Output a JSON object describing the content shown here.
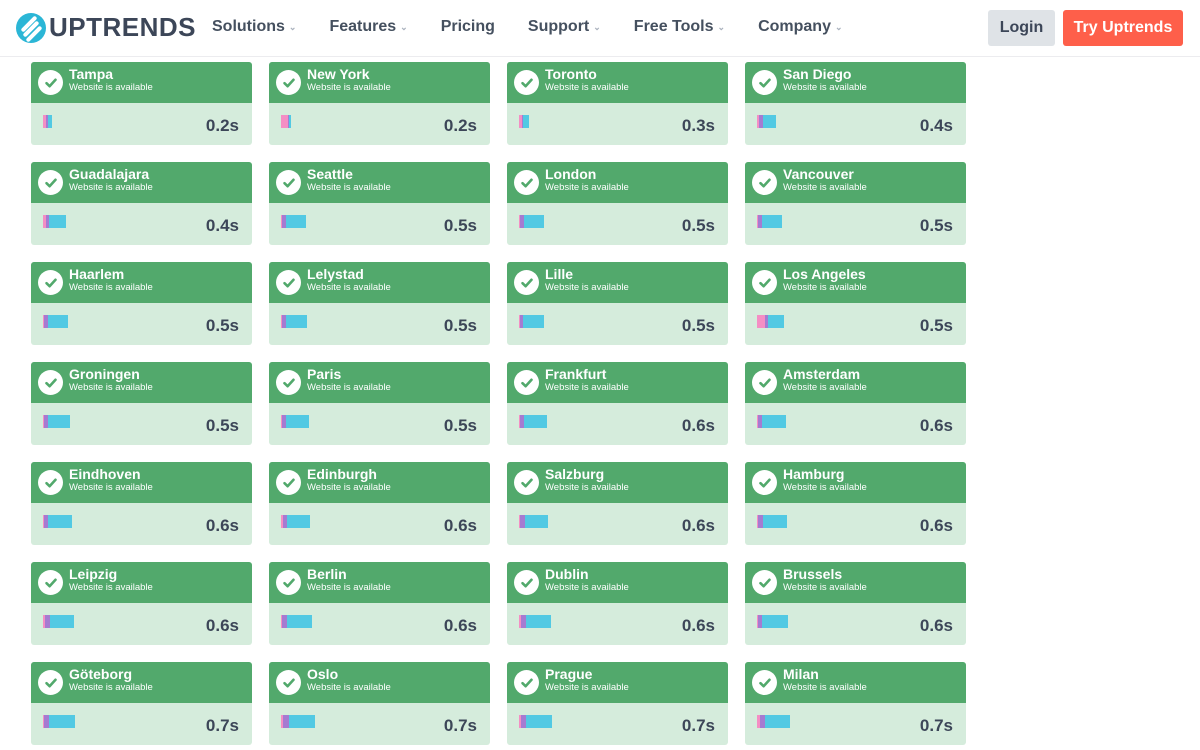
{
  "brand": {
    "name": "UPTRENDS",
    "logo_icon": "uptrends-logo-icon",
    "accent": "#2bb6d6"
  },
  "nav": {
    "items": [
      {
        "label": "Solutions",
        "dropdown": true
      },
      {
        "label": "Features",
        "dropdown": true
      },
      {
        "label": "Pricing",
        "dropdown": false
      },
      {
        "label": "Support",
        "dropdown": true
      },
      {
        "label": "Free Tools",
        "dropdown": true
      },
      {
        "label": "Company",
        "dropdown": true
      }
    ],
    "chevron": "⌄",
    "login_label": "Login",
    "try_label": "Try Uptrends"
  },
  "colors": {
    "card_header": "#52a96c",
    "card_body": "#d5ecdc",
    "dns": "#f48ec4",
    "connect": "#a57bd1",
    "download": "#52c9e3",
    "cta": "#fe5f4a"
  },
  "checkpoints": [
    {
      "city": "Tampa",
      "status": "Website is available",
      "time": "0.2s",
      "segments": [
        30,
        20,
        50
      ]
    },
    {
      "city": "New York",
      "status": "Website is available",
      "time": "0.2s",
      "segments": [
        80,
        15,
        25
      ]
    },
    {
      "city": "Toronto",
      "status": "Website is available",
      "time": "0.3s",
      "segments": [
        30,
        15,
        75
      ]
    },
    {
      "city": "San Diego",
      "status": "Website is available",
      "time": "0.4s",
      "segments": [
        25,
        45,
        150
      ]
    },
    {
      "city": "Guadalajara",
      "status": "Website is available",
      "time": "0.4s",
      "segments": [
        35,
        40,
        200
      ]
    },
    {
      "city": "Seattle",
      "status": "Website is available",
      "time": "0.5s",
      "segments": [
        15,
        45,
        240
      ]
    },
    {
      "city": "London",
      "status": "Website is available",
      "time": "0.5s",
      "segments": [
        10,
        45,
        230
      ]
    },
    {
      "city": "Vancouver",
      "status": "Website is available",
      "time": "0.5s",
      "segments": [
        10,
        50,
        230
      ]
    },
    {
      "city": "Haarlem",
      "status": "Website is available",
      "time": "0.5s",
      "segments": [
        10,
        45,
        230
      ]
    },
    {
      "city": "Lelystad",
      "status": "Website is available",
      "time": "0.5s",
      "segments": [
        10,
        45,
        245
      ]
    },
    {
      "city": "Lille",
      "status": "Website is available",
      "time": "0.5s",
      "segments": [
        15,
        40,
        250
      ]
    },
    {
      "city": "Los Angeles",
      "status": "Website is available",
      "time": "0.5s",
      "segments": [
        90,
        35,
        190
      ]
    },
    {
      "city": "Groningen",
      "status": "Website is available",
      "time": "0.5s",
      "segments": [
        10,
        50,
        255
      ]
    },
    {
      "city": "Paris",
      "status": "Website is available",
      "time": "0.5s",
      "segments": [
        15,
        45,
        265
      ]
    },
    {
      "city": "Frankfurt",
      "status": "Website is available",
      "time": "0.6s",
      "segments": [
        10,
        45,
        275
      ]
    },
    {
      "city": "Amsterdam",
      "status": "Website is available",
      "time": "0.6s",
      "segments": [
        10,
        50,
        280
      ]
    },
    {
      "city": "Eindhoven",
      "status": "Website is available",
      "time": "0.6s",
      "segments": [
        10,
        50,
        285
      ]
    },
    {
      "city": "Edinburgh",
      "status": "Website is available",
      "time": "0.6s",
      "segments": [
        20,
        45,
        275
      ]
    },
    {
      "city": "Salzburg",
      "status": "Website is available",
      "time": "0.6s",
      "segments": [
        15,
        55,
        275
      ]
    },
    {
      "city": "Hamburg",
      "status": "Website is available",
      "time": "0.6s",
      "segments": [
        15,
        55,
        280
      ]
    },
    {
      "city": "Leipzig",
      "status": "Website is available",
      "time": "0.6s",
      "segments": [
        20,
        55,
        285
      ]
    },
    {
      "city": "Berlin",
      "status": "Website is available",
      "time": "0.6s",
      "segments": [
        10,
        60,
        295
      ]
    },
    {
      "city": "Dublin",
      "status": "Website is available",
      "time": "0.6s",
      "segments": [
        20,
        55,
        295
      ]
    },
    {
      "city": "Brussels",
      "status": "Website is available",
      "time": "0.6s",
      "segments": [
        15,
        50,
        310
      ]
    },
    {
      "city": "Göteborg",
      "status": "Website is available",
      "time": "0.7s",
      "segments": [
        15,
        60,
        310
      ]
    },
    {
      "city": "Oslo",
      "status": "Website is available",
      "time": "0.7s",
      "segments": [
        20,
        65,
        300
      ]
    },
    {
      "city": "Prague",
      "status": "Website is available",
      "time": "0.7s",
      "segments": [
        25,
        60,
        310
      ]
    },
    {
      "city": "Milan",
      "status": "Website is available",
      "time": "0.7s",
      "segments": [
        40,
        55,
        295
      ]
    }
  ]
}
